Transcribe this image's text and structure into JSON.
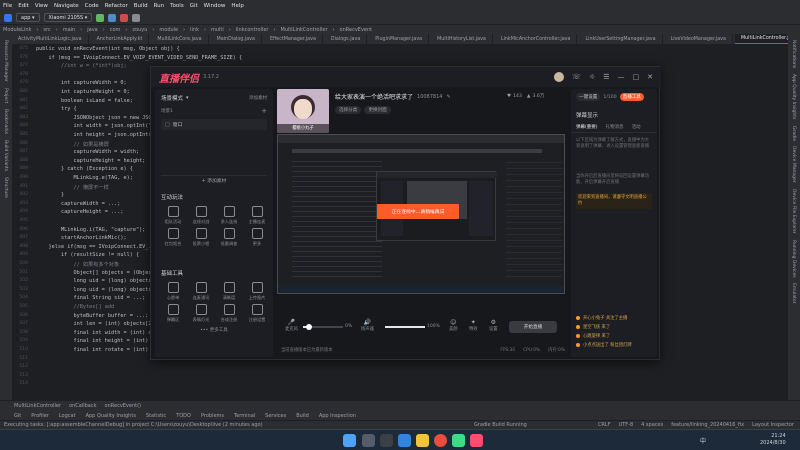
{
  "ide": {
    "menu": [
      "File",
      "Edit",
      "View",
      "Navigate",
      "Code",
      "Refactor",
      "Build",
      "Run",
      "Tools",
      "Git",
      "Window",
      "Help"
    ],
    "toolbar": {
      "module": "app",
      "device": "Xiaomi 2105S",
      "run_label": "▶",
      "debug_label": "Debug"
    },
    "breadcrumb": [
      "ModuleLink",
      "src",
      "main",
      "java",
      "com",
      "zouyu",
      "module",
      "link",
      "multi",
      "linkcontroller",
      "MultiLinkController",
      "onRecvEvent"
    ],
    "tabs": [
      "ActivityMultiLinkLogic.java",
      "AnchorLinkApply.kt",
      "MultiLinkCore.java",
      "MainDialog.java",
      "EffectManager.java",
      "Dialogs.java",
      "PluginManager.java",
      "MultiHistoryList.java",
      "LinkMicAnchorController.java",
      "LinkUserSettingManager.java",
      "LiveVideoManager.java",
      "MultiLinkController.java"
    ],
    "active_tab": "MultiLinkController.java",
    "sidebar_left": [
      "Resource Manager",
      "Project",
      "Bookmarks",
      "Build Variants",
      "Structure"
    ],
    "sidebar_right": [
      "Notifications",
      "App Quality Insights",
      "Gradle",
      "Device Manager",
      "Device File Explorer",
      "Running Devices",
      "Emulator"
    ],
    "gutter": [
      "475",
      "476",
      "477",
      "478",
      "479",
      "480",
      "481",
      "482",
      "483",
      "484",
      "485",
      "486",
      "487",
      "488",
      "489",
      "490",
      "491",
      "492",
      "493",
      "494",
      "495",
      "496",
      "497",
      "498",
      "499",
      "500",
      "501",
      "502",
      "503",
      "504",
      "505",
      "506",
      "507",
      "508",
      "509",
      "510",
      "511",
      "512",
      "513",
      "514"
    ],
    "code": [
      "public void onRecvEvent(int msg, Object obj) {",
      "    if (msg == IVoipConnect.EV_VOIP_EVENT_VIDEO_SEND_FRAME_SIZE) {",
      "        //int w = (*int*)obj;",
      "",
      "        int captureWidth = 0;",
      "        int captureHeight = 0;",
      "        boolean isLand = false;",
      "        try {",
      "            JSONObject json = new JSONObject(obj.toString());",
      "            int width = json.optInt(\"w\");",
      "            int height = json.optInt(\"h\");",
      "            // 如果是横屏",
      "            captureWidth = width;",
      "            captureHeight = height;",
      "        } catch (Exception e) {",
      "            MLinkLog.e(TAG, e);",
      "            // 横屏不一样",
      "        }",
      "        captureWidth = ...;",
      "        captureHeight = ...;",
      "",
      "        MLinkLog.i(TAG, \"capture\");",
      "        startAnchorLinkMic();",
      "    }else if(msg == IVoipConnect.EV_...) {",
      "        if (resultSize != null) {",
      "            // 如果有多个对象",
      "            Object[] objects = (Object[]) obj;",
      "            long uid = (long) objects[0];",
      "            long uid = (long) objects[1];",
      "            final String sid = ...;",
      "            //Bytes[] add",
      "            byteBuffer buffer = ...;",
      "            int len = (int) objects[2];",
      "            final int width = (int) objects[3];",
      "            final int height = (int) objects[4];",
      "            final int rotate = (int) objects[5];"
    ],
    "bottom_breadcrumb": [
      "MultiLinkController",
      "onCallback",
      "onRecvEvent()"
    ],
    "run_tabs": [
      "Git",
      "Profiler",
      "Logcat",
      "App Quality Insights",
      "Statistic",
      "TODO",
      "Problems",
      "Terminal",
      "Services",
      "Build",
      "App Inspection"
    ],
    "status_text": "Executing tasks: [:app:assembleChannelDebug] in project C:\\Users\\zouyu\\Desktop\\live (2 minutes ago)",
    "gradle_status": "Gradle Build Running",
    "status_right": [
      "CRLF",
      "UTF-8",
      "4 spaces",
      "feature/linking_20240416_fix",
      "Layout Inspector"
    ]
  },
  "live": {
    "app_name": "直播伴侣",
    "version": "3.17.2",
    "header": {
      "user_name": "樱桃小丸子",
      "room_title": "给大家表演一个绝活吧求求了",
      "room_id": "10087814",
      "category": "选择分类",
      "edit_cover": "更换封面",
      "follower_label": "关注",
      "follower_count": "143",
      "likes_label": "点赞",
      "likes_count": "3.6万",
      "stat_label": "人气",
      "stat_count": "0",
      "ticket_label": "票",
      "ticket_count": "1/100",
      "top_buttons": [
        "一键设置",
        "设置",
        "帮助",
        "直播工具"
      ]
    },
    "scene": {
      "title": "场景模式",
      "scene_btn": "场景1",
      "add_source": "添加素材",
      "source_item": "窗口",
      "add_source_btn": "+ 添加素材"
    },
    "interact": {
      "title": "互动玩法",
      "tools": [
        "组队活动",
        "连线对战",
        "多人连线",
        "主播连麦",
        "红包饭合",
        "投票小程",
        "低量调查",
        "更多"
      ]
    },
    "basic": {
      "title": "基础工具",
      "tools": [
        "心愿单",
        "连麦通讯",
        "清晰度",
        "上传图片",
        "弹幕区",
        "表情灯光",
        "合成注册",
        "注册设置"
      ],
      "more": "••• 更多工具"
    },
    "preview": {
      "overlay_text": "正在连线中…请稍候再试"
    },
    "controls": {
      "mic_label": "麦克风",
      "mic_value": "0%",
      "speaker_label": "扬声器",
      "speaker_value": "100%",
      "speaker_level": 1.0,
      "mic_level": 0.15,
      "beauty": "美颜",
      "special": "特效",
      "settings": "设置",
      "start_button": "开始直播",
      "tip": "当前直播版本已为最新版本",
      "stats": [
        "FPS:30",
        "CPU:0%",
        "内存:0%"
      ]
    },
    "right": {
      "title": "弹幕显示",
      "tabs": [
        "弹幕(重要)",
        "礼物消息",
        "活动"
      ],
      "text1": "以下区域为弹幕了解方式，直播中为大家说明了弹幕，进入设置管理面板直播",
      "text2": "当你开启后直播间里将返回设置弹幕功能，开启弹幕开启直播",
      "highlight": "欢迎来到直播间，请遵守文明直播公约",
      "messages": [
        "开心小兔子 关注了主播",
        "星空飞侠 来了",
        "心跳旋律 来了",
        "小点点送出了 粉丝团灯牌"
      ]
    }
  },
  "taskbar": {
    "time": "21:24",
    "date": "2024/8/30",
    "lang": "中"
  },
  "colors": {
    "accent": "#ff5a2a",
    "pink": "#ff4d6d",
    "ide_bg": "#1e1f22",
    "panel": "#2b2d30"
  }
}
